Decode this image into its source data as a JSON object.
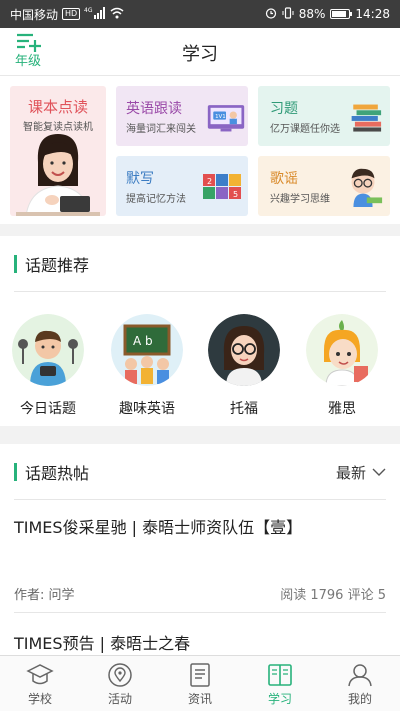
{
  "status_bar": {
    "carrier": "中国移动",
    "hd_badge": "HD",
    "network": "4G",
    "battery": "88%",
    "battery_level": 0.88,
    "time": "14:28"
  },
  "header": {
    "grade_label": "年级",
    "title": "学习"
  },
  "features": {
    "textbook": {
      "title": "课本点读",
      "subtitle": "智能复读点读机"
    },
    "english": {
      "title": "英语跟读",
      "subtitle": "海量词汇来闯关"
    },
    "exercise": {
      "title": "习题",
      "subtitle": "亿万课题任你选"
    },
    "dictation": {
      "title": "默写",
      "subtitle": "提高记忆方法"
    },
    "song": {
      "title": "歌谣",
      "subtitle": "兴趣学习思维"
    }
  },
  "topics": {
    "title": "话题推荐",
    "items": [
      {
        "label": "今日话题",
        "icon": "news-reporter-icon"
      },
      {
        "label": "趣味英语",
        "icon": "kids-blackboard-icon"
      },
      {
        "label": "托福",
        "icon": "teacher-icon"
      },
      {
        "label": "雅思",
        "icon": "student-icon"
      }
    ]
  },
  "posts": {
    "title": "话题热帖",
    "sort_label": "最新",
    "items": [
      {
        "title": "TIMES俊采星驰 | 泰晤士师资队伍【壹】",
        "author": "作者: 问学",
        "stats": "阅读 1796 评论 5"
      },
      {
        "title": "TIMES预告 | 泰晤士之春",
        "author": "",
        "stats": ""
      }
    ]
  },
  "bottom_nav": {
    "items": [
      {
        "label": "学校",
        "icon": "graduation-cap-icon",
        "active": false
      },
      {
        "label": "活动",
        "icon": "location-pin-icon",
        "active": false
      },
      {
        "label": "资讯",
        "icon": "news-icon",
        "active": false
      },
      {
        "label": "学习",
        "icon": "book-icon",
        "active": true
      },
      {
        "label": "我的",
        "icon": "user-icon",
        "active": false
      }
    ]
  },
  "colors": {
    "accent": "#27b27b",
    "status_bar": "#3d3d3d"
  }
}
